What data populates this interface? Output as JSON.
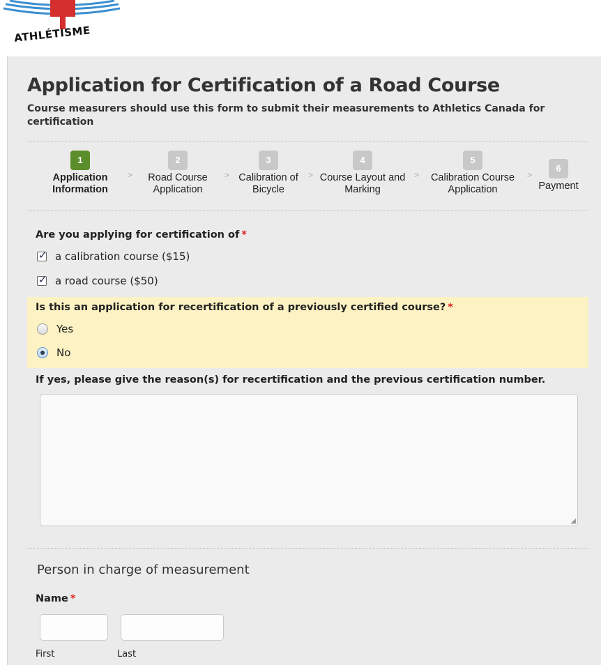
{
  "logo": {
    "text": "ATHLÉTISME",
    "colors": {
      "blue": "#3a8fd1",
      "red": "#d32f2f"
    }
  },
  "header": {
    "title": "Application for Certification of a Road Course",
    "subtitle": "Course measurers should use this form to submit their measurements to Athletics Canada for certification"
  },
  "steps": [
    {
      "num": "1",
      "label": "Application Information",
      "active": true
    },
    {
      "num": "2",
      "label": "Road Course Application",
      "active": false
    },
    {
      "num": "3",
      "label": "Calibration of Bicycle",
      "active": false
    },
    {
      "num": "4",
      "label": "Course Layout and Marking",
      "active": false
    },
    {
      "num": "5",
      "label": "Calibration Course Application",
      "active": false
    },
    {
      "num": "6",
      "label": "Payment",
      "active": false
    }
  ],
  "step_separator": ">",
  "form": {
    "cert_question": "Are you applying for certification of",
    "cert_options": [
      {
        "label": "a calibration course ($15)",
        "checked": true
      },
      {
        "label": "a road course ($50)",
        "checked": true
      }
    ],
    "recert_question": "Is this an application for recertification of a previously certified course?",
    "recert_options": [
      {
        "label": "Yes",
        "selected": false
      },
      {
        "label": "No",
        "selected": true
      }
    ],
    "reason_label": "If yes, please give the reason(s) for recertification and the previous certification number.",
    "reason_value": "",
    "section_heading": "Person in charge of measurement",
    "name_label": "Name",
    "first_label": "First",
    "last_label": "Last",
    "required_mark": "*"
  },
  "colors": {
    "active_step": "#5b8d2a",
    "inactive_step": "#c8c8c8",
    "highlight": "#fcf2c3",
    "required": "#dd2222"
  }
}
